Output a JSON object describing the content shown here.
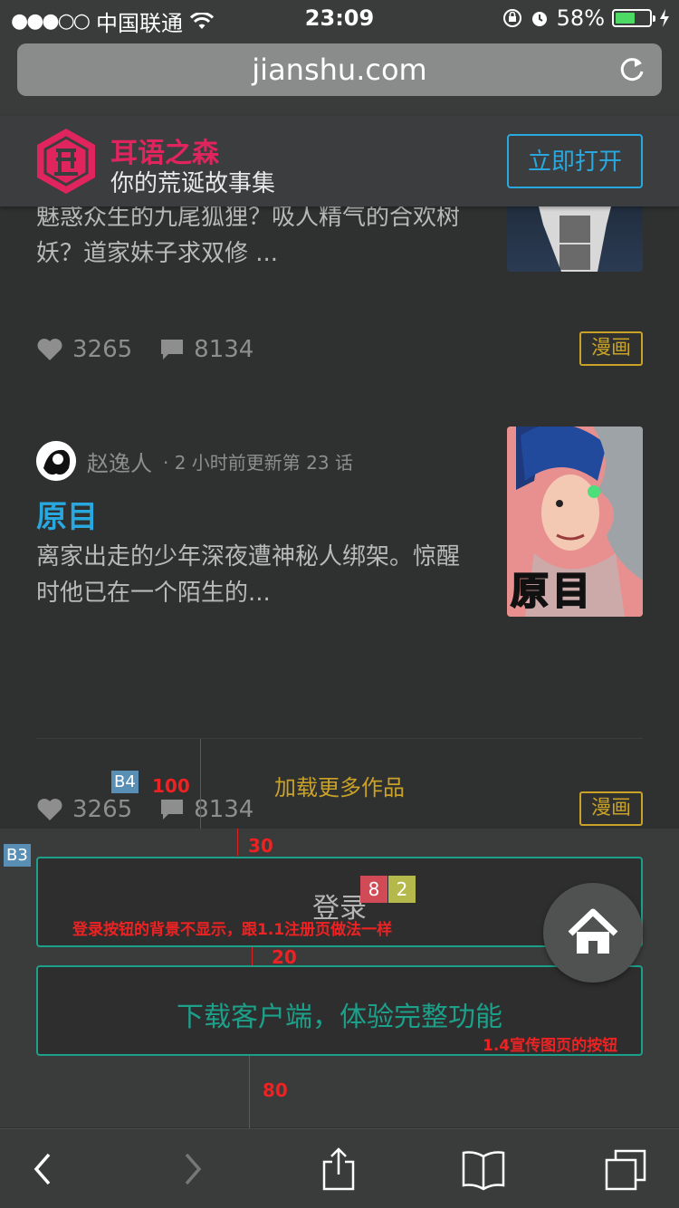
{
  "status_bar": {
    "signal": "●●●○○",
    "carrier": "中国联通",
    "time": "23:09",
    "battery_percent": "58%",
    "battery_level": 0.58
  },
  "browser": {
    "url": "jianshu.com"
  },
  "app_banner": {
    "name": "耳语之森",
    "tagline": "你的荒诞故事集",
    "open_button": "立即打开",
    "brand_color": "#e0245e",
    "accent_color": "#29a8e0"
  },
  "feed": {
    "items": [
      {
        "description": "魅惑众生的九尾狐狸？吸人精气的合欢树妖？道家妹子求双修 ...",
        "likes": "3265",
        "comments": "8134",
        "tag": "漫画"
      },
      {
        "author": "赵逸人",
        "update_info": "· 2 小时前更新第 23 话",
        "title": "原目",
        "description": "离家出走的少年深夜遭神秘人绑架。惊醒时他已在一个陌生的...",
        "likes": "3265",
        "comments": "8134",
        "tag": "漫画",
        "cover_text": "原目"
      }
    ],
    "load_more": "加载更多作品"
  },
  "annotations": {
    "b4_label": "B4",
    "b4_value": "100",
    "b3_label": "B3",
    "gap_top": "30",
    "gap_mid": "20",
    "gap_bottom": "80",
    "login_note": "登录按钮的背景不显示，跟1.1注册页做法一样",
    "download_note": "1.4宣传图页的按钮",
    "badge_red": "8",
    "badge_olive": "2"
  },
  "actions": {
    "login": "登录",
    "download": "下载客户端，体验完整功能"
  }
}
